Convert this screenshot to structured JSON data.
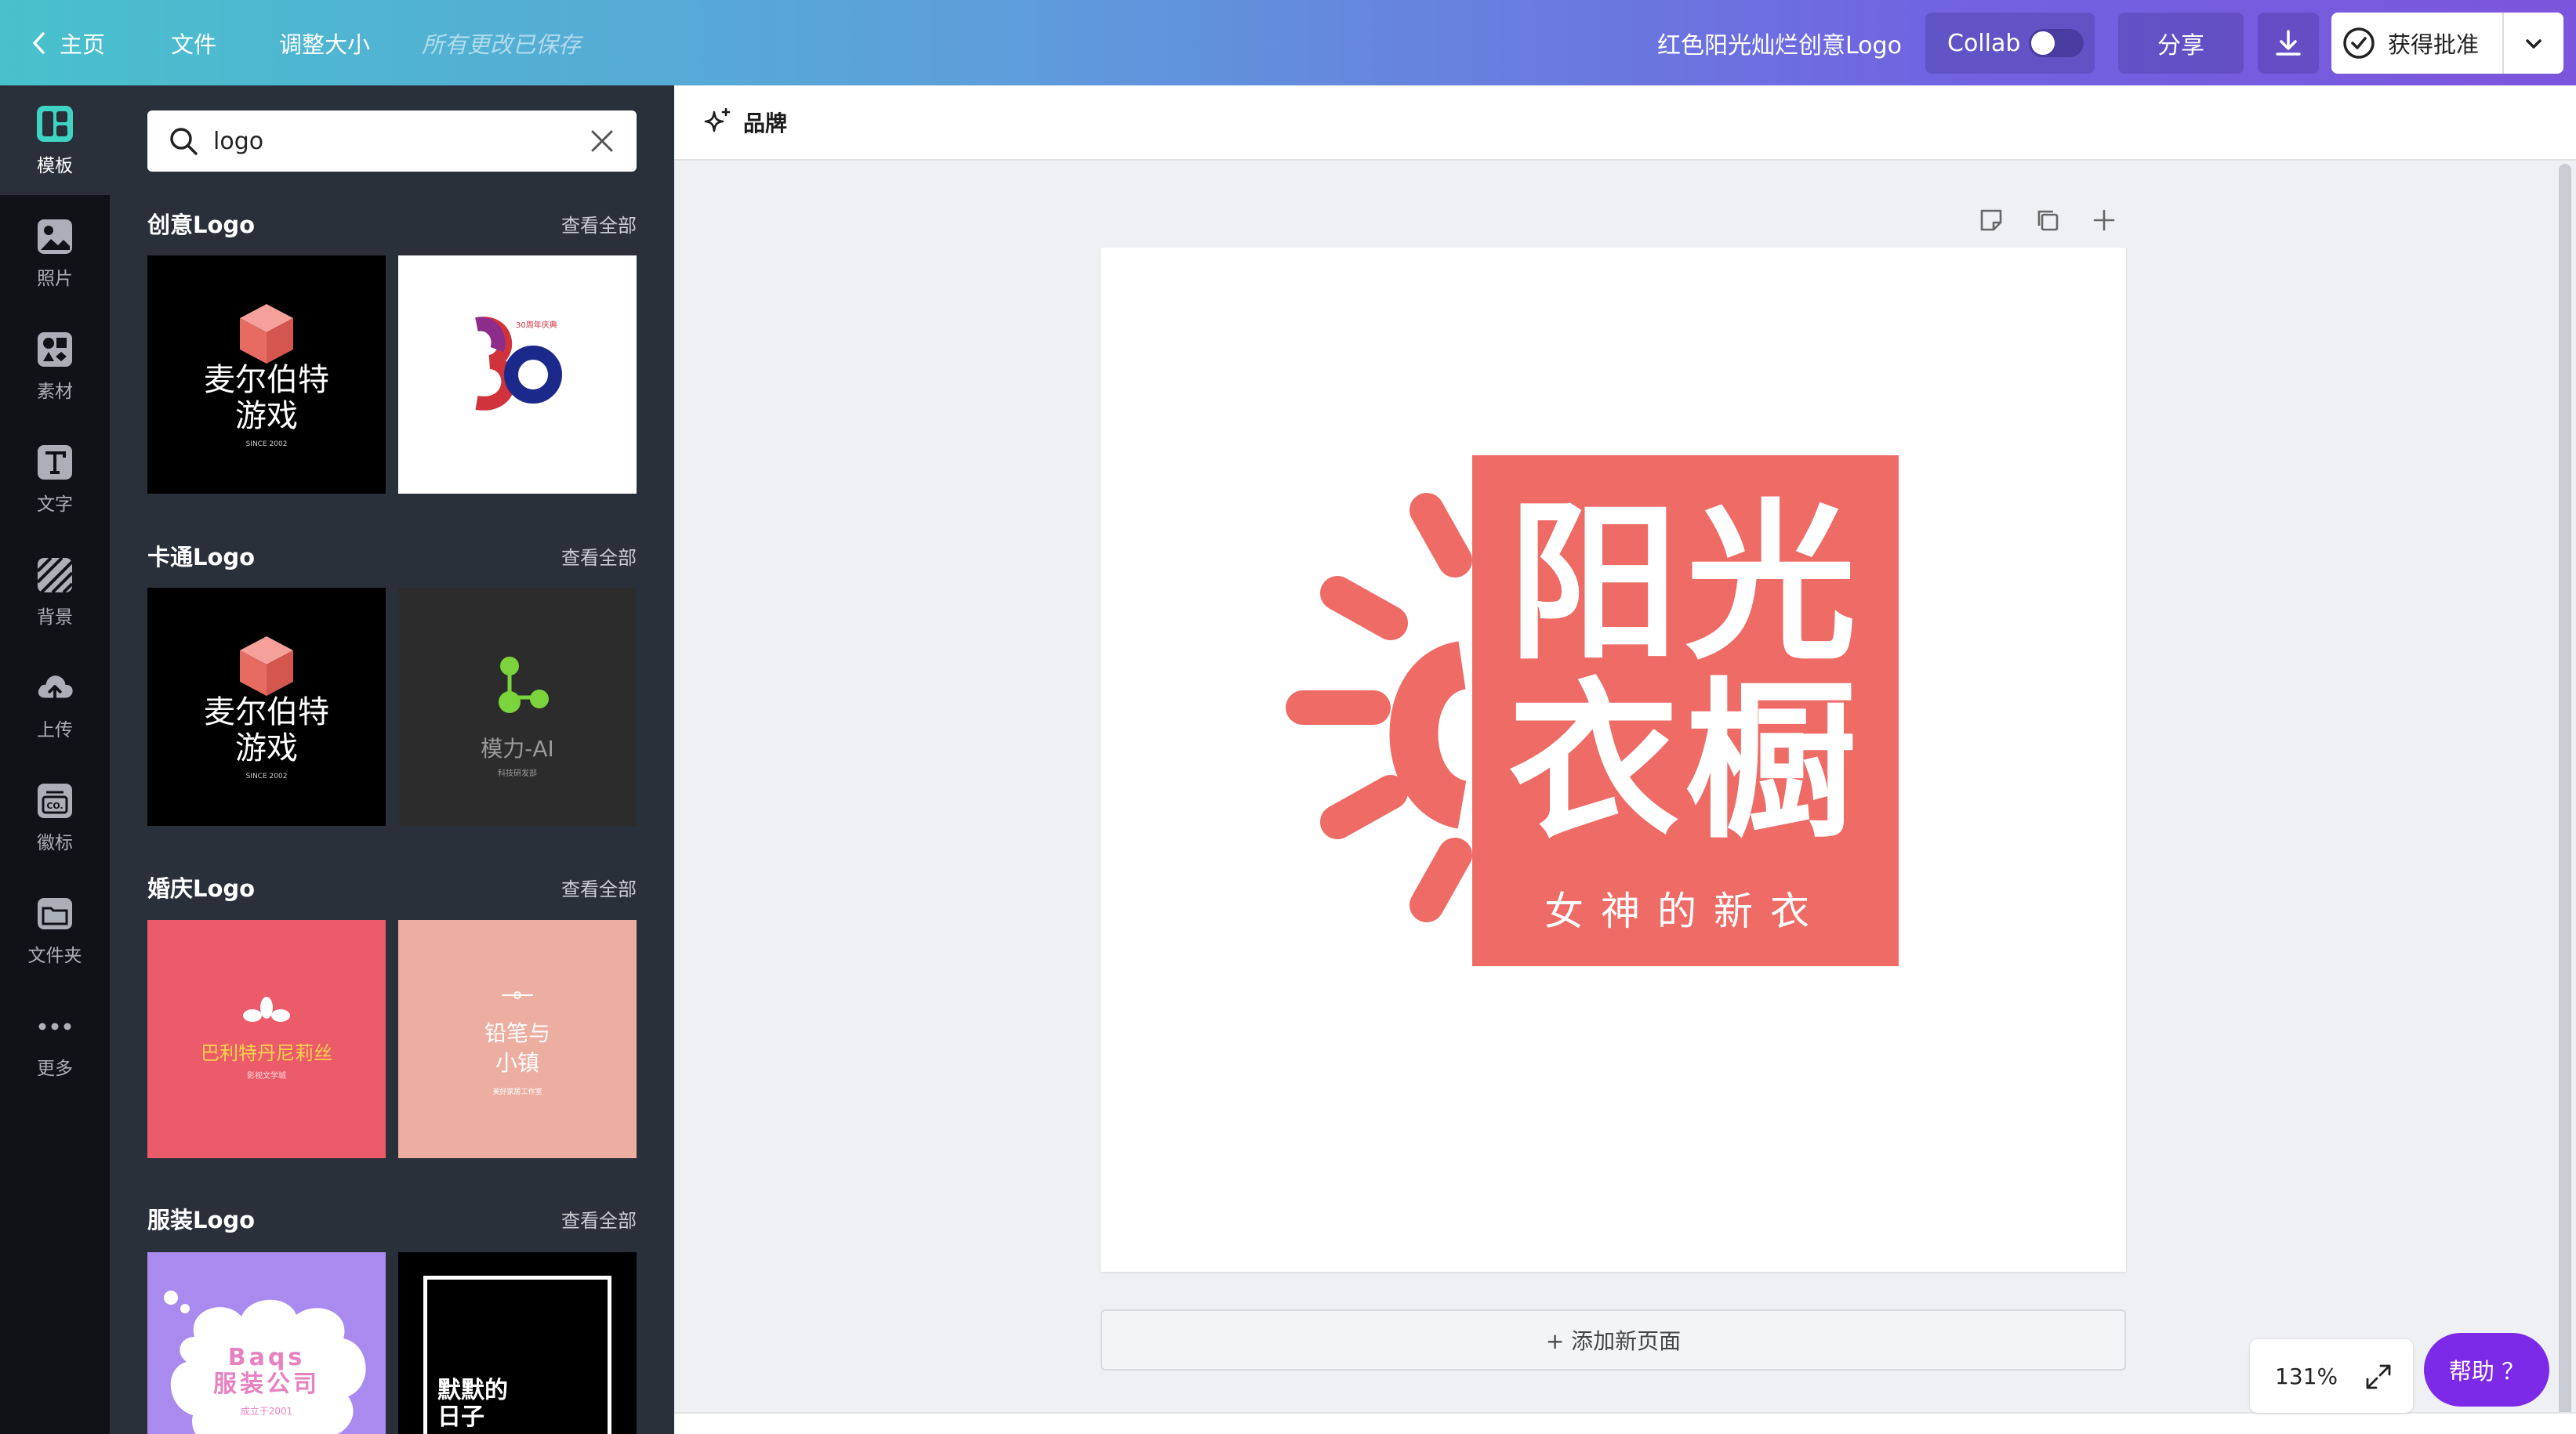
{
  "topbar": {
    "home": "主页",
    "file": "文件",
    "resize": "调整大小",
    "saved": "所有更改已保存",
    "doc_title": "红色阳光灿烂创意Logo",
    "collab": "Collab",
    "share": "分享",
    "approve": "获得批准"
  },
  "rail": [
    {
      "label": "模板",
      "icon": "template-icon"
    },
    {
      "label": "照片",
      "icon": "photo-icon"
    },
    {
      "label": "素材",
      "icon": "elements-icon"
    },
    {
      "label": "文字",
      "icon": "text-icon"
    },
    {
      "label": "背景",
      "icon": "background-icon"
    },
    {
      "label": "上传",
      "icon": "upload-icon"
    },
    {
      "label": "徽标",
      "icon": "badge-icon"
    },
    {
      "label": "文件夹",
      "icon": "folder-icon"
    },
    {
      "label": "更多",
      "icon": "more-icon"
    }
  ],
  "search": {
    "value": "logo"
  },
  "sections": [
    {
      "title": "创意Logo",
      "see_all": "查看全部",
      "thumbs": [
        {
          "text": "麦尔伯特\n游戏",
          "small": "SINCE 2002",
          "bg": "#000000"
        },
        {
          "text": "30周年庆典",
          "small": "",
          "bg": "#ffffff"
        }
      ]
    },
    {
      "title": "卡通Logo",
      "see_all": "查看全部",
      "thumbs": [
        {
          "text": "麦尔伯特\n游戏",
          "small": "SINCE 2002",
          "bg": "#000000"
        },
        {
          "text": "模力-AI",
          "small": "科技研发部",
          "bg": "#2c2c2c"
        }
      ]
    },
    {
      "title": "婚庆Logo",
      "see_all": "查看全部",
      "thumbs": [
        {
          "text": "巴利特丹尼莉丝",
          "small": "影视文学城",
          "bg": "#ec5b6a"
        },
        {
          "text": "铅笔与\n小镇",
          "small": "美好家居工作室",
          "bg": "#ecaea1"
        }
      ]
    },
    {
      "title": "服装Logo",
      "see_all": "查看全部",
      "thumbs": [
        {
          "text": "Baqs\n服装公司",
          "small": "成立于2001",
          "bg": "#a98bf0"
        },
        {
          "text": "默默的\n日子",
          "small": "",
          "bg": "#000000"
        }
      ]
    }
  ],
  "workspace": {
    "brand": "品牌",
    "add_page": "+ 添加新页面",
    "zoom": "131%",
    "help": "帮助 ？"
  },
  "logo": {
    "line1": "阳光",
    "line2": "衣橱",
    "tagline": "女神的新衣",
    "color": "#ee6b66"
  }
}
